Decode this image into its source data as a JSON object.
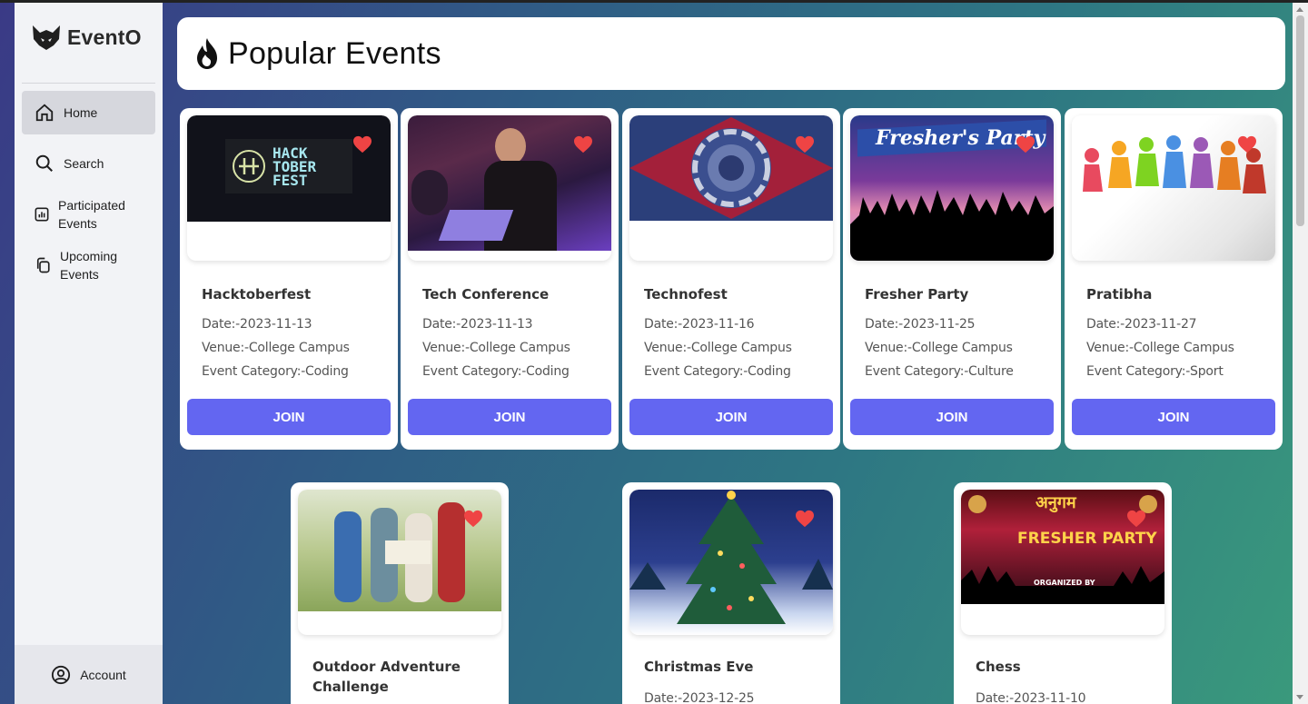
{
  "app": {
    "name": "EventO"
  },
  "sidebar": {
    "items": [
      {
        "label": "Home",
        "icon": "home-icon",
        "active": true
      },
      {
        "label": "Search",
        "icon": "search-icon"
      },
      {
        "label": "Participated\nEvents",
        "icon": "chart-icon"
      },
      {
        "label": "Upcoming\nEvents",
        "icon": "copy-icon"
      }
    ],
    "account": {
      "label": "Account",
      "icon": "user-circle-icon"
    }
  },
  "header": {
    "title": "Popular Events",
    "icon": "fire-icon"
  },
  "colors": {
    "accent": "#6366f1",
    "heart": "#ef4444"
  },
  "events": [
    {
      "title": "Hacktoberfest",
      "date": "Date:-2023-11-13",
      "venue": "Venue:-College Campus",
      "category": "Event Category:-Coding",
      "button": "JOIN"
    },
    {
      "title": "Tech Conference",
      "date": "Date:-2023-11-13",
      "venue": "Venue:-College Campus",
      "category": "Event Category:-Coding",
      "button": "JOIN"
    },
    {
      "title": "Technofest",
      "date": "Date:-2023-11-16",
      "venue": "Venue:-College Campus",
      "category": "Event Category:-Coding",
      "button": "JOIN"
    },
    {
      "title": "Fresher Party",
      "date": "Date:-2023-11-25",
      "venue": "Venue:-College Campus",
      "category": "Event Category:-Culture",
      "button": "JOIN"
    },
    {
      "title": "Pratibha",
      "date": "Date:-2023-11-27",
      "venue": "Venue:-College Campus",
      "category": "Event Category:-Sport",
      "button": "JOIN"
    },
    {
      "title": "Outdoor Adventure Challenge",
      "date": "",
      "venue": "",
      "category": "",
      "button": ""
    },
    {
      "title": "Christmas Eve",
      "date": "Date:-2023-12-25",
      "venue": "",
      "category": "",
      "button": ""
    },
    {
      "title": "Chess",
      "date": "Date:-2023-11-10",
      "venue": "",
      "category": "",
      "button": ""
    }
  ],
  "image_text": {
    "hacktoberfest": "HACK TOBER FEST",
    "fresher": "Fresher's Party",
    "chess_top": "अनुगम",
    "chess_main": "FRESHER PARTY",
    "chess_sub": "ORGANIZED BY"
  }
}
